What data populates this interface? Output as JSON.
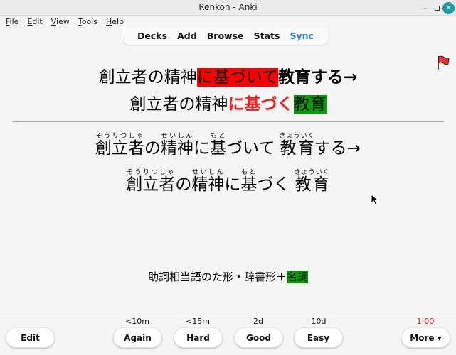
{
  "window": {
    "title": "Renkon - Anki",
    "minimize_icon": "minimize-icon",
    "maximize_icon": "maximize-icon",
    "close_icon": "close-icon"
  },
  "menubar": {
    "items": [
      {
        "label": "File",
        "mnemonic": "F",
        "rest": "ile"
      },
      {
        "label": "Edit",
        "mnemonic": "E",
        "rest": "dit"
      },
      {
        "label": "View",
        "mnemonic": "V",
        "rest": "iew"
      },
      {
        "label": "Tools",
        "mnemonic": "T",
        "rest": "ools"
      },
      {
        "label": "Help",
        "mnemonic": "H",
        "rest": "elp"
      }
    ]
  },
  "topnav": {
    "items": [
      "Decks",
      "Add",
      "Browse",
      "Stats",
      "Sync"
    ],
    "sync_color": "#2a7de1"
  },
  "card": {
    "flag_icon": "red-flag-icon",
    "flag_color": "#ff3333",
    "front_line1": {
      "plain": "創立者の精神",
      "highlight_red": "に基づいて",
      "bold": "教育する→"
    },
    "front_line2": {
      "plain": "創立者の精神",
      "red_bold": "に基づく",
      "highlight_green": "教育"
    },
    "reading_line1": [
      {
        "base": "創立者",
        "ruby": "そうりつしゃ"
      },
      {
        "text": "の"
      },
      {
        "base": "精神",
        "ruby": "せいしん"
      },
      {
        "text": "に"
      },
      {
        "base": "基",
        "ruby": "もと"
      },
      {
        "text": "づいて"
      },
      {
        "base": "教育",
        "ruby": "きょういく"
      },
      {
        "text": "する→"
      }
    ],
    "reading_line2": [
      {
        "base": "創立者",
        "ruby": "そうりつしゃ"
      },
      {
        "text": "の"
      },
      {
        "base": "精神",
        "ruby": "せいしん"
      },
      {
        "text": "に"
      },
      {
        "base": "基",
        "ruby": "もと"
      },
      {
        "text": "づく"
      },
      {
        "base": "教育",
        "ruby": "きょういく"
      }
    ],
    "note": {
      "plain": "助詞相当語のた形・辞書形＋",
      "highlight_green": "名詞"
    },
    "highlight_red_color": "#ff0000",
    "highlight_green_color": "#00a000"
  },
  "bottombar": {
    "edit_label": "Edit",
    "answers": [
      {
        "label": "Again",
        "interval": "<10m"
      },
      {
        "label": "Hard",
        "interval": "<15m"
      },
      {
        "label": "Good",
        "interval": "2d"
      },
      {
        "label": "Easy",
        "interval": "10d"
      }
    ],
    "timer": "1:00",
    "timer_color": "#e01e1e",
    "more_label": "More ▾"
  }
}
